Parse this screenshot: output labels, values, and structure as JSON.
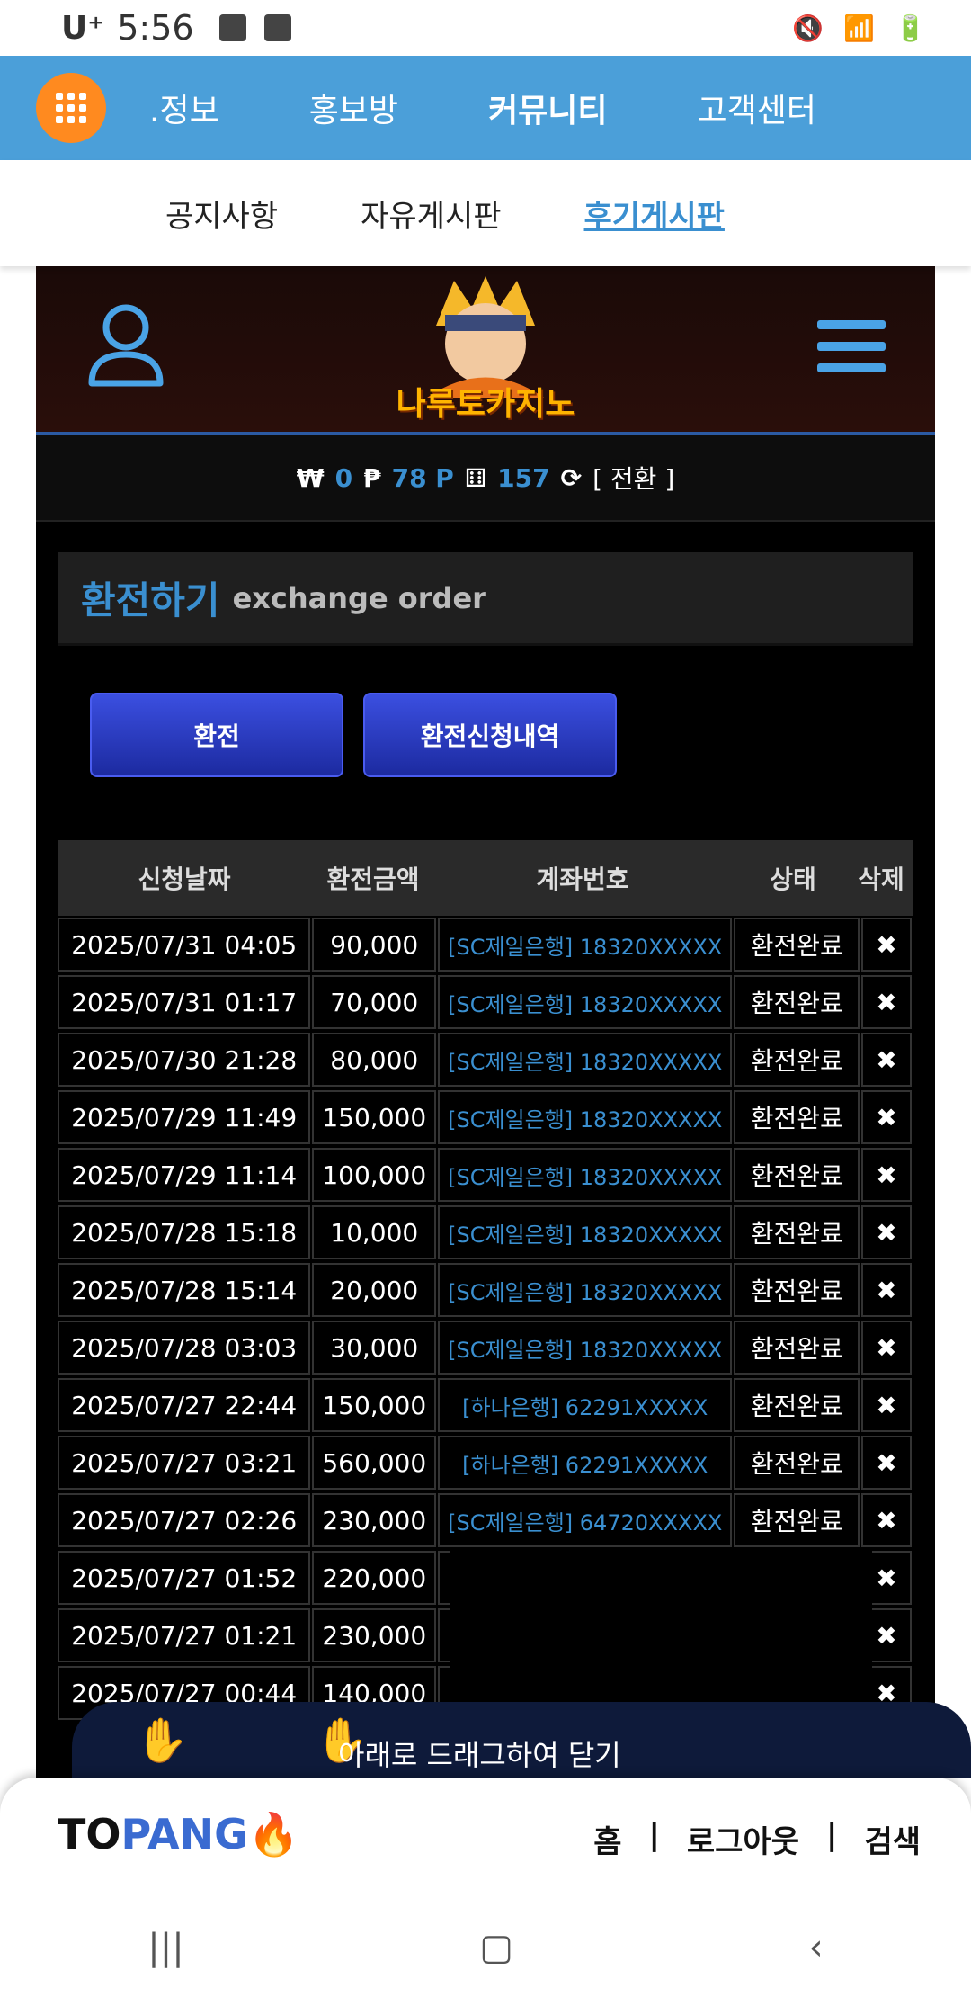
{
  "status": {
    "carrier": "U⁺",
    "time": "5:56"
  },
  "top_nav": {
    "items": [
      ".정보",
      "홍보방",
      "커뮤니티",
      "고객센터"
    ]
  },
  "sub_nav": {
    "items": [
      "공지사항",
      "자유게시판",
      "후기게시판"
    ]
  },
  "site": {
    "logo_text": "나루토카지노",
    "balance": {
      "won": "0",
      "point": "78 P",
      "count": "157",
      "swap": "[ 전환 ]"
    }
  },
  "section": {
    "title_ko": "환전하기",
    "title_en": "exchange order"
  },
  "buttons": {
    "exchange": "환전",
    "history": "환전신청내역"
  },
  "table": {
    "headers": [
      "신청날짜",
      "환전금액",
      "계좌번호",
      "상태",
      "삭제"
    ],
    "rows": [
      [
        "2025/07/31 04:05",
        "90,000",
        "[SC제일은행] 18320XXXXX",
        "환전완료"
      ],
      [
        "2025/07/31 01:17",
        "70,000",
        "[SC제일은행] 18320XXXXX",
        "환전완료"
      ],
      [
        "2025/07/30 21:28",
        "80,000",
        "[SC제일은행] 18320XXXXX",
        "환전완료"
      ],
      [
        "2025/07/29 11:49",
        "150,000",
        "[SC제일은행] 18320XXXXX",
        "환전완료"
      ],
      [
        "2025/07/29 11:14",
        "100,000",
        "[SC제일은행] 18320XXXXX",
        "환전완료"
      ],
      [
        "2025/07/28 15:18",
        "10,000",
        "[SC제일은행] 18320XXXXX",
        "환전완료"
      ],
      [
        "2025/07/28 15:14",
        "20,000",
        "[SC제일은행] 18320XXXXX",
        "환전완료"
      ],
      [
        "2025/07/28 03:03",
        "30,000",
        "[SC제일은행] 18320XXXXX",
        "환전완료"
      ],
      [
        "2025/07/27 22:44",
        "150,000",
        "[하나은행] 62291XXXXX",
        "환전완료"
      ],
      [
        "2025/07/27 03:21",
        "560,000",
        "[하나은행] 62291XXXXX",
        "환전완료"
      ],
      [
        "2025/07/27 02:26",
        "230,000",
        "[SC제일은행] 64720XXXXX",
        "환전완료"
      ],
      [
        "2025/07/27 01:52",
        "220,000",
        "",
        ""
      ],
      [
        "2025/07/27 01:21",
        "230,000",
        "",
        ""
      ],
      [
        "2025/07/27 00:44",
        "140,000",
        "",
        ""
      ]
    ]
  },
  "drag_hint": "아래로 드래그하여 닫기",
  "footer": {
    "brand_a": "TO",
    "brand_b": "PANG",
    "links": [
      "홈",
      "|",
      "로그아웃",
      "|",
      "검색"
    ]
  },
  "colors": {
    "accent": "#3a8fd0",
    "nav_bg": "#4b9fd9",
    "menu_orange": "#ff8a1f",
    "button_blue": "#2b3ec9"
  }
}
